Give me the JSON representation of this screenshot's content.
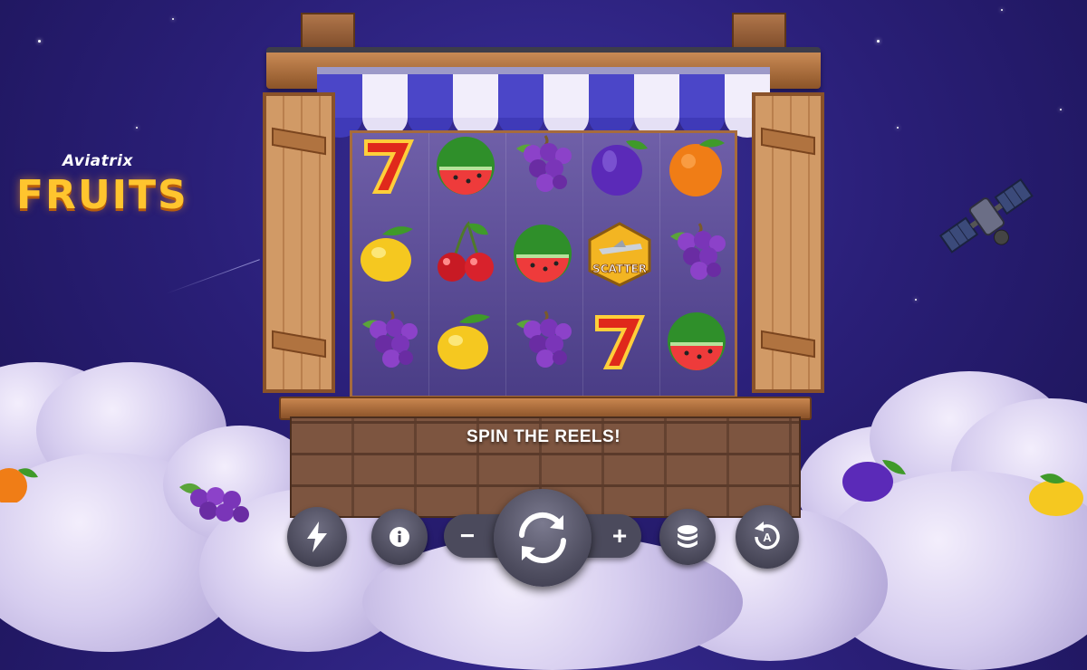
{
  "brand": {
    "sub": "Aviatrix",
    "title": "FRUITS"
  },
  "message": "SPIN THE REELS!",
  "reels": [
    [
      "seven",
      "watermelon",
      "grapes",
      "plum",
      "orange"
    ],
    [
      "lemon",
      "cherries",
      "watermelon",
      "scatter",
      "grapes"
    ],
    [
      "grapes",
      "lemon",
      "grapes",
      "seven",
      "watermelon"
    ]
  ],
  "scatter_label": "SCATTER",
  "controls": {
    "turbo": "lightning-icon",
    "info": "info-icon",
    "minus": "−",
    "plus": "+",
    "spin": "spin-arrows-icon",
    "coins": "coin-stack-icon",
    "autoplay": "autoplay-icon",
    "autoplay_letter": "A"
  },
  "colors": {
    "sky": "#2a1f78",
    "brand_gold": "#ffc52e",
    "control": "#4b4a5c",
    "wood": "#b97f4d"
  }
}
